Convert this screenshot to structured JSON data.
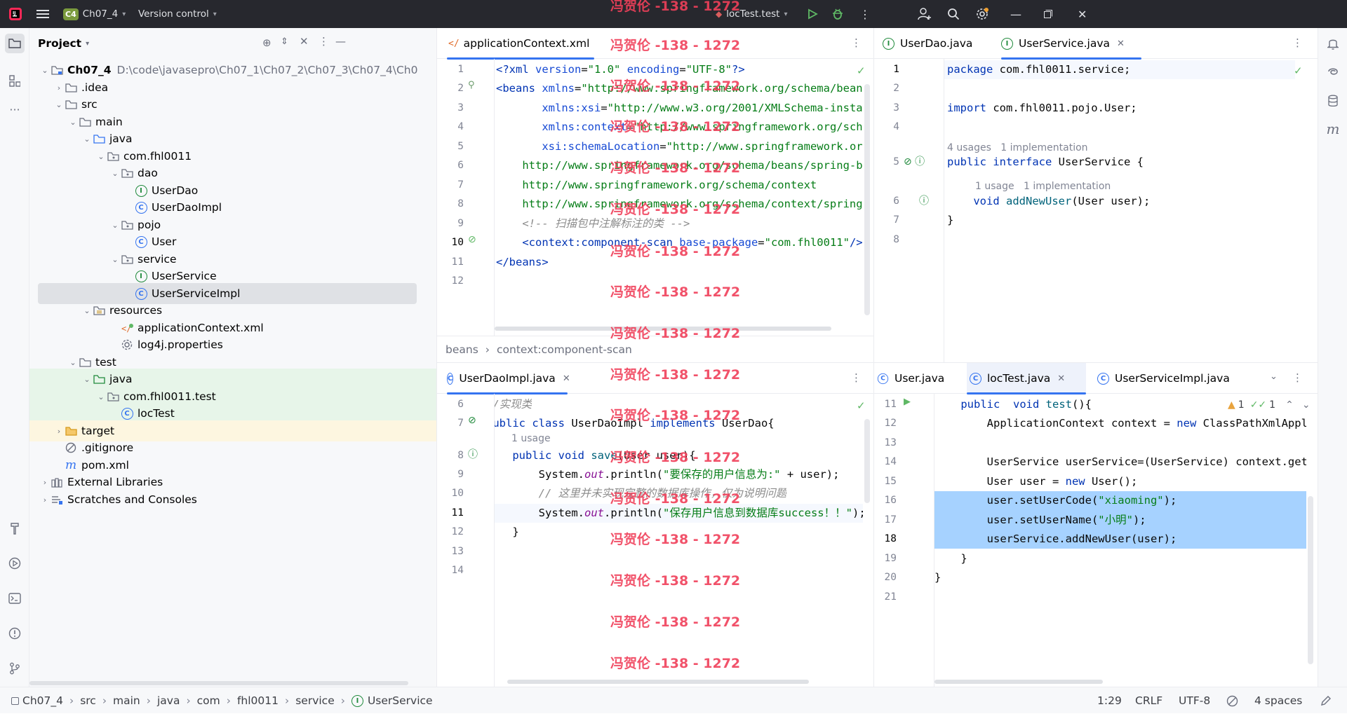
{
  "titlebar": {
    "project_badge": "C4",
    "project_name": "Ch07_4",
    "vcs_label": "Version control",
    "run_config": "locTest.test",
    "colors": {
      "bg": "#27282e",
      "run": "#5fb865",
      "badge": "#7a9a3d"
    }
  },
  "watermark": "冯贺伦 -138 - 1272",
  "project_panel": {
    "title": "Project",
    "tree": [
      {
        "label": "Ch07_4",
        "extra": "D:\\code\\javasepro\\Ch07_1\\Ch07_2\\Ch07_3\\Ch07_4\\Ch0",
        "icon": "module-folder-icon",
        "bold": true
      },
      {
        "label": ".idea",
        "icon": "folder-icon"
      },
      {
        "label": "src",
        "icon": "folder-icon"
      },
      {
        "label": "main",
        "icon": "folder-icon"
      },
      {
        "label": "java",
        "icon": "source-folder-icon"
      },
      {
        "label": "com.fhl0011",
        "icon": "package-icon"
      },
      {
        "label": "dao",
        "icon": "package-icon"
      },
      {
        "label": "UserDao",
        "icon": "interface-icon"
      },
      {
        "label": "UserDaoImpl",
        "icon": "class-icon"
      },
      {
        "label": "pojo",
        "icon": "package-icon"
      },
      {
        "label": "User",
        "icon": "class-icon"
      },
      {
        "label": "service",
        "icon": "package-icon"
      },
      {
        "label": "UserService",
        "icon": "interface-icon"
      },
      {
        "label": "UserServiceImpl",
        "icon": "class-icon"
      },
      {
        "label": "resources",
        "icon": "resources-folder-icon"
      },
      {
        "label": "applicationContext.xml",
        "icon": "spring-xml-icon"
      },
      {
        "label": "log4j.properties",
        "icon": "properties-icon"
      },
      {
        "label": "test",
        "icon": "folder-icon"
      },
      {
        "label": "java",
        "icon": "test-source-folder-icon"
      },
      {
        "label": "com.fhl0011.test",
        "icon": "package-icon"
      },
      {
        "label": "locTest",
        "icon": "class-icon"
      },
      {
        "label": "target",
        "icon": "excluded-folder-icon"
      },
      {
        "label": ".gitignore",
        "icon": "gitignore-icon"
      },
      {
        "label": "pom.xml",
        "icon": "maven-icon"
      },
      {
        "label": "External Libraries",
        "icon": "libraries-icon"
      },
      {
        "label": "Scratches and Consoles",
        "icon": "scratches-icon"
      }
    ]
  },
  "editor_tl": {
    "tab": "applicationContext.xml",
    "breadcrumb": [
      "beans",
      "context:component-scan"
    ],
    "gutter": [
      "1",
      "2",
      "3",
      "4",
      "5",
      "6",
      "7",
      "8",
      "9",
      "10",
      "11",
      "12"
    ]
  },
  "editor_tr": {
    "tabs": [
      "UserDao.java",
      "UserService.java"
    ],
    "gutter": [
      "1",
      "2",
      "3",
      "4",
      "5",
      "6",
      "7",
      "8"
    ],
    "hint1": [
      "4 usages",
      "1 implementation"
    ],
    "hint2": [
      "1 usage",
      "1 implementation"
    ]
  },
  "editor_bl": {
    "tab": "UserDaoImpl.java",
    "gutter": [
      "6",
      "7",
      "8",
      "9",
      "10",
      "11",
      "12",
      "13",
      "14"
    ],
    "hint": "1 usage"
  },
  "editor_br": {
    "tabs": [
      "User.java",
      "locTest.java",
      "UserServiceImpl.java"
    ],
    "gutter": [
      "11",
      "12",
      "13",
      "14",
      "15",
      "16",
      "17",
      "18",
      "19",
      "20",
      "21"
    ],
    "warnings": "1",
    "checks": "1"
  },
  "statusbar": {
    "breadcrumb": [
      "Ch07_4",
      "src",
      "main",
      "java",
      "com",
      "fhl0011",
      "service",
      "UserService"
    ],
    "position": "1:29",
    "line_ending": "CRLF",
    "encoding": "UTF-8",
    "indent": "4 spaces"
  }
}
